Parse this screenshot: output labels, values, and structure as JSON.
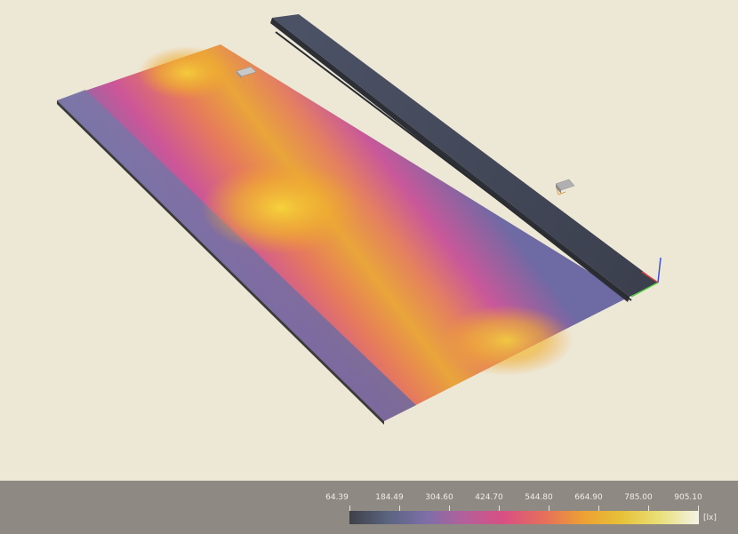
{
  "viewer": {
    "background_color": "#ede8d6",
    "legend_background_color": "#8e8a83"
  },
  "scale": {
    "ticks": [
      "64.39",
      "184.49",
      "304.60",
      "424.70",
      "544.80",
      "664.90",
      "785.00",
      "905.10"
    ],
    "unit": "[lx]",
    "colors": [
      "#3f4148",
      "#5a6480",
      "#7d6fa8",
      "#b4609a",
      "#d84f83",
      "#e6705a",
      "#eda133",
      "#e6c238",
      "#e9e07a",
      "#f4f2e6"
    ]
  },
  "axes_gizmo": {
    "icon": "xyz-axes-icon",
    "colors": {
      "x": "#d84040",
      "y": "#55d040",
      "z": "#4050e0"
    }
  },
  "luminaires": [
    {
      "icon": "luminaire-icon"
    },
    {
      "icon": "luminaire-icon"
    }
  ]
}
